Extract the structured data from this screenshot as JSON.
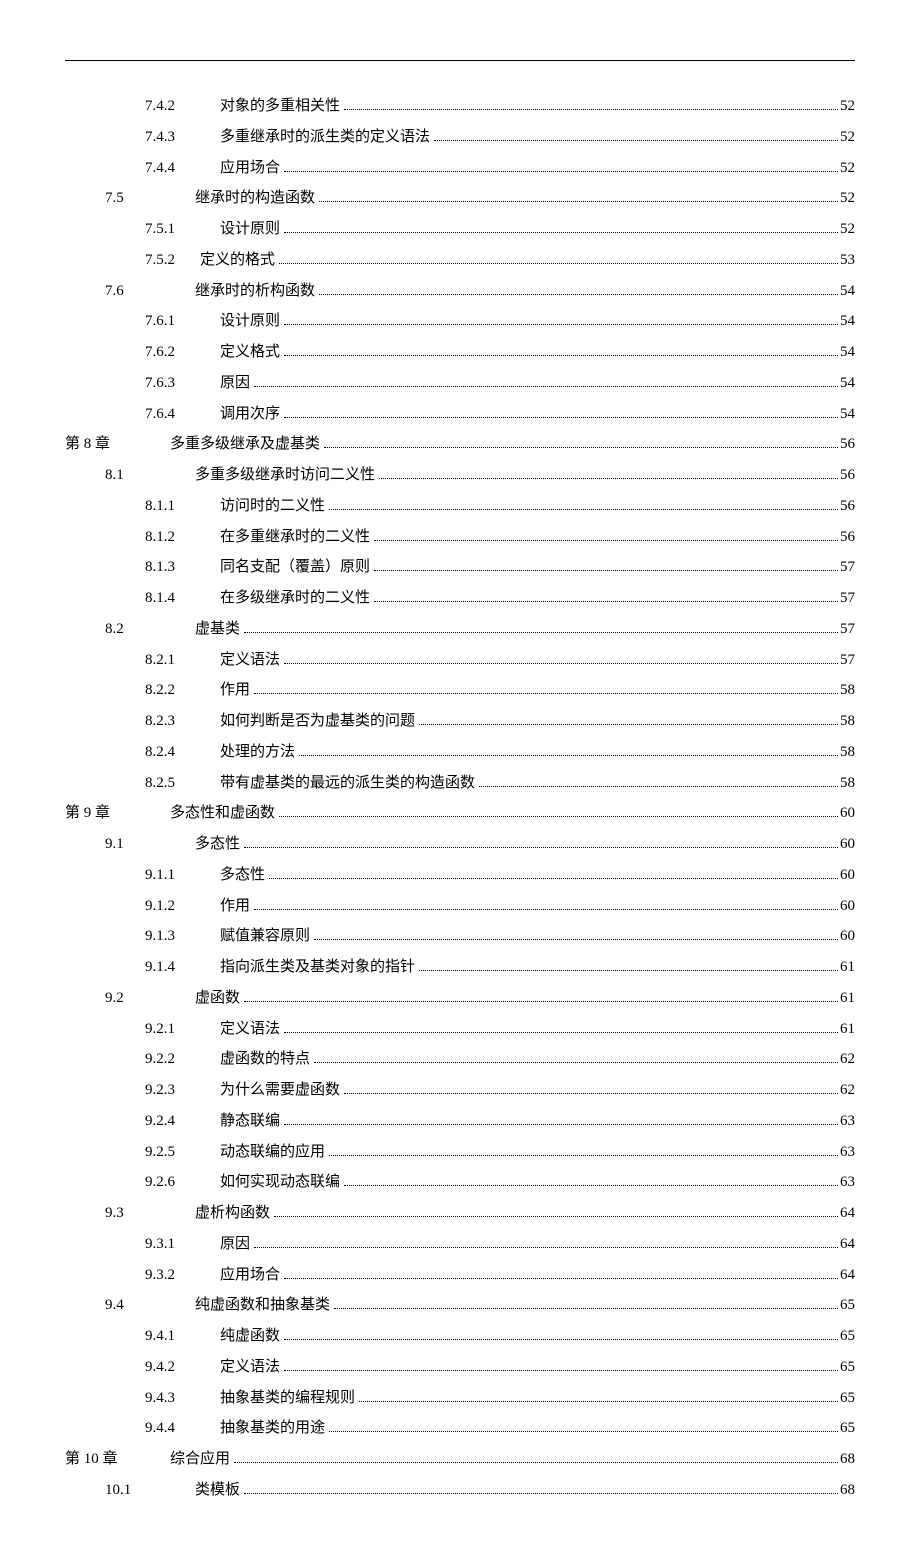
{
  "toc": [
    {
      "level": "ss",
      "label": "7.4.2",
      "title": "对象的多重相关性",
      "page": "52"
    },
    {
      "level": "ss",
      "label": "7.4.3",
      "title": "多重继承时的派生类的定义语法",
      "page": "52"
    },
    {
      "level": "ss",
      "label": "7.4.4",
      "title": "应用场合",
      "page": "52"
    },
    {
      "level": "s",
      "label": "7.5",
      "title": "继承时的构造函数",
      "page": "52"
    },
    {
      "level": "ss",
      "label": "7.5.1",
      "title": "设计原则",
      "page": "52"
    },
    {
      "level": "ss",
      "label": "7.5.2",
      "title": "定义的格式",
      "page": "53",
      "tight": true
    },
    {
      "level": "s",
      "label": "7.6",
      "title": "继承时的析构函数",
      "page": "54"
    },
    {
      "level": "ss",
      "label": "7.6.1",
      "title": "设计原则",
      "page": "54"
    },
    {
      "level": "ss",
      "label": "7.6.2",
      "title": "定义格式",
      "page": "54"
    },
    {
      "level": "ss",
      "label": "7.6.3",
      "title": "原因",
      "page": "54"
    },
    {
      "level": "ss",
      "label": "7.6.4",
      "title": "调用次序",
      "page": "54"
    },
    {
      "level": "ch",
      "label": "第 8 章",
      "title": "多重多级继承及虚基类",
      "page": "56"
    },
    {
      "level": "s",
      "label": "8.1",
      "title": "多重多级继承时访问二义性",
      "page": "56"
    },
    {
      "level": "ss",
      "label": "8.1.1",
      "title": "访问时的二义性",
      "page": "56"
    },
    {
      "level": "ss",
      "label": "8.1.2",
      "title": "在多重继承时的二义性",
      "page": "56"
    },
    {
      "level": "ss",
      "label": "8.1.3",
      "title": "同名支配（覆盖）原则",
      "page": "57"
    },
    {
      "level": "ss",
      "label": "8.1.4",
      "title": "在多级继承时的二义性",
      "page": "57"
    },
    {
      "level": "s",
      "label": "8.2",
      "title": "虚基类",
      "page": "57"
    },
    {
      "level": "ss",
      "label": "8.2.1",
      "title": "定义语法",
      "page": "57"
    },
    {
      "level": "ss",
      "label": "8.2.2",
      "title": "作用",
      "page": "58"
    },
    {
      "level": "ss",
      "label": "8.2.3",
      "title": "如何判断是否为虚基类的问题",
      "page": "58"
    },
    {
      "level": "ss",
      "label": "8.2.4",
      "title": "处理的方法",
      "page": "58"
    },
    {
      "level": "ss",
      "label": "8.2.5",
      "title": "带有虚基类的最远的派生类的构造函数",
      "page": "58"
    },
    {
      "level": "ch",
      "label": "第 9 章",
      "title": "多态性和虚函数",
      "page": "60"
    },
    {
      "level": "s",
      "label": "9.1",
      "title": "多态性",
      "page": "60"
    },
    {
      "level": "ss",
      "label": "9.1.1",
      "title": "多态性",
      "page": "60"
    },
    {
      "level": "ss",
      "label": "9.1.2",
      "title": "作用",
      "page": "60"
    },
    {
      "level": "ss",
      "label": "9.1.3",
      "title": "赋值兼容原则",
      "page": "60"
    },
    {
      "level": "ss",
      "label": "9.1.4",
      "title": "指向派生类及基类对象的指针",
      "page": "61"
    },
    {
      "level": "s",
      "label": "9.2",
      "title": "虚函数",
      "page": "61"
    },
    {
      "level": "ss",
      "label": "9.2.1",
      "title": "定义语法",
      "page": "61"
    },
    {
      "level": "ss",
      "label": "9.2.2",
      "title": "虚函数的特点",
      "page": "62"
    },
    {
      "level": "ss",
      "label": "9.2.3",
      "title": "为什么需要虚函数",
      "page": "62"
    },
    {
      "level": "ss",
      "label": "9.2.4",
      "title": "静态联编",
      "page": "63"
    },
    {
      "level": "ss",
      "label": "9.2.5",
      "title": "动态联编的应用",
      "page": "63"
    },
    {
      "level": "ss",
      "label": "9.2.6",
      "title": "如何实现动态联编",
      "page": "63"
    },
    {
      "level": "s",
      "label": "9.3",
      "title": "虚析构函数",
      "page": "64"
    },
    {
      "level": "ss",
      "label": "9.3.1",
      "title": "原因",
      "page": "64"
    },
    {
      "level": "ss",
      "label": "9.3.2",
      "title": "应用场合",
      "page": "64"
    },
    {
      "level": "s",
      "label": "9.4",
      "title": "纯虚函数和抽象基类",
      "page": "65"
    },
    {
      "level": "ss",
      "label": "9.4.1",
      "title": "纯虚函数",
      "page": "65"
    },
    {
      "level": "ss",
      "label": "9.4.2",
      "title": "定义语法",
      "page": "65"
    },
    {
      "level": "ss",
      "label": "9.4.3",
      "title": "抽象基类的编程规则",
      "page": "65"
    },
    {
      "level": "ss",
      "label": "9.4.4",
      "title": "抽象基类的用途",
      "page": "65"
    },
    {
      "level": "ch",
      "label": "第 10 章",
      "title": "综合应用",
      "page": "68"
    },
    {
      "level": "s",
      "label": "10.1",
      "title": "类模板",
      "page": "68"
    }
  ]
}
